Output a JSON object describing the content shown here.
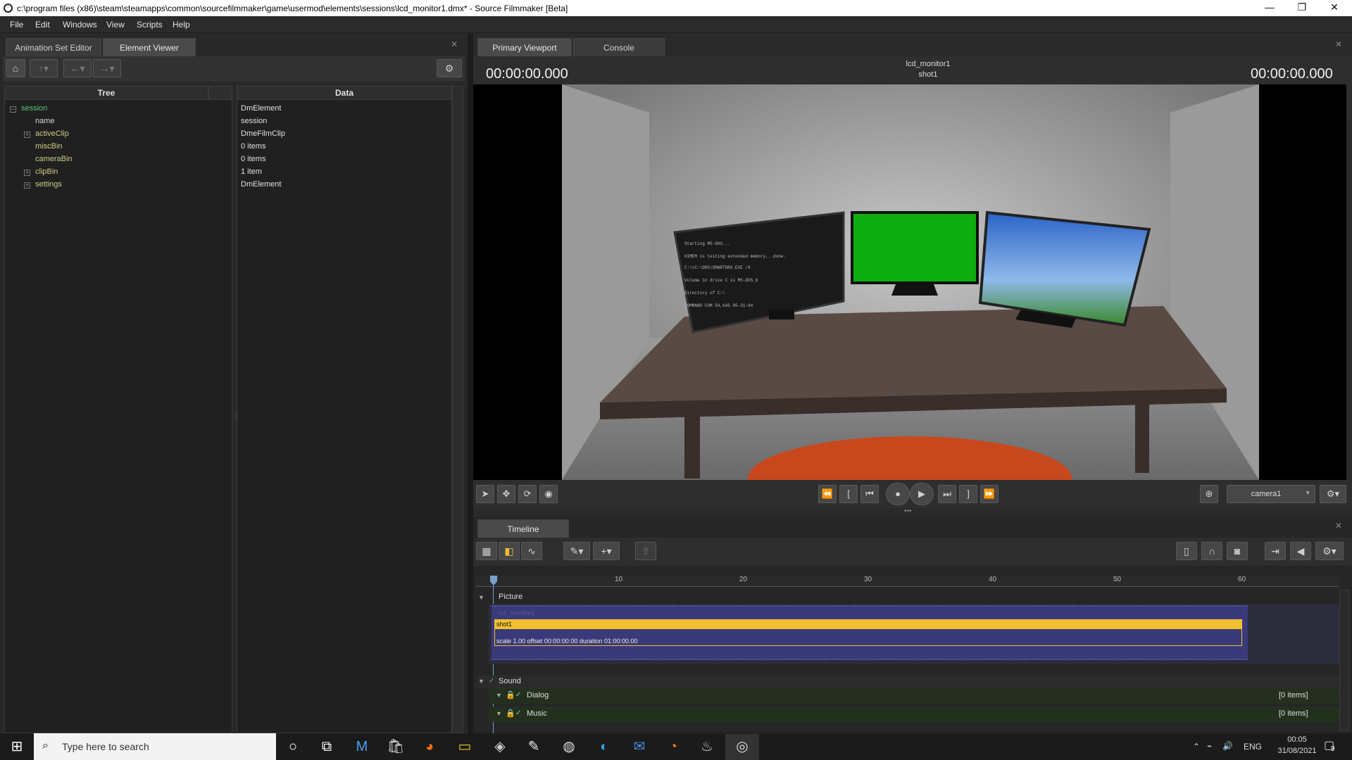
{
  "window": {
    "title": "c:\\program files (x86)\\steam\\steamapps\\common\\sourcefilmmaker\\game\\usermod\\elements\\sessions\\lcd_monitor1.dmx* - Source Filmmaker [Beta]",
    "minimize": "—",
    "restore": "❐",
    "close": "✕"
  },
  "menu": [
    "File",
    "Edit",
    "Windows",
    "View",
    "Scripts",
    "Help"
  ],
  "left_panel": {
    "tabs": [
      "Animation Set Editor",
      "Element Viewer"
    ],
    "active_tab": "Element Viewer",
    "columns": {
      "tree": "Tree",
      "data": "Data"
    },
    "rows": [
      {
        "name": "session",
        "value": "DmElement"
      },
      {
        "name": "name",
        "value": "session"
      },
      {
        "name": "activeClip",
        "value": "DmeFilmClip"
      },
      {
        "name": "miscBin",
        "value": "0 items"
      },
      {
        "name": "cameraBin",
        "value": "0 items"
      },
      {
        "name": "clipBin",
        "value": "1 item"
      },
      {
        "name": "settings",
        "value": "DmElement"
      }
    ]
  },
  "viewport": {
    "tabs": [
      "Primary Viewport",
      "Console"
    ],
    "active_tab": "Primary Viewport",
    "time_left": "00:00:00.000",
    "time_right": "00:00:00.000",
    "clip_name": "lcd_monitor1",
    "shot_name": "shot1",
    "camera": "camera1"
  },
  "timeline": {
    "tab": "Timeline",
    "ruler": [
      "10",
      "20",
      "30",
      "40",
      "50",
      "60"
    ],
    "picture_label": "Picture",
    "film_label": "lcd_monitor1",
    "shot_label": "shot1",
    "shot_info": "scale 1.00 offset  00:00:00.00 duration  01:00:00.00",
    "sound_label": "Sound",
    "tracks": [
      {
        "name": "Dialog",
        "count": "[0 items]"
      },
      {
        "name": "Music",
        "count": "[0 items]"
      }
    ]
  },
  "taskbar": {
    "search_placeholder": "Type here to search",
    "lang": "ENG",
    "time": "00:05",
    "date": "31/08/2021",
    "notif_count": "9"
  },
  "colors": {
    "shot_yellow": "#f0c030",
    "clip_purple": "#3a3a7a",
    "root_green": "#60c080",
    "monitor_green": "#10b010"
  }
}
